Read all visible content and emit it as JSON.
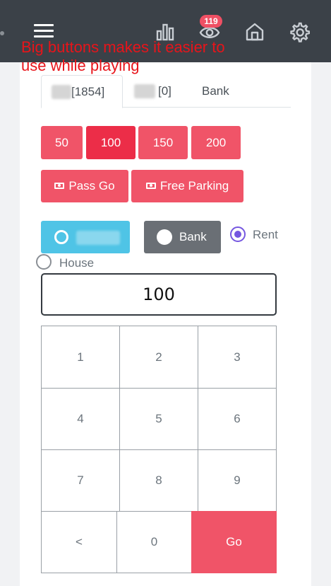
{
  "annotation": "Big buttons makes it easier to use while playing",
  "nav": {
    "menu_icon": "hamburger-menu-icon",
    "icons": [
      "bar-chart-icon",
      "eye-icon",
      "home-icon",
      "gear-icon"
    ],
    "eye_badge": "119"
  },
  "tabs": [
    {
      "label": "[1854]",
      "active": true
    },
    {
      "label": "[0]",
      "active": false
    },
    {
      "label": "Bank",
      "active": false
    }
  ],
  "amount_buttons": [
    "50",
    "100",
    "150",
    "200"
  ],
  "selected_amount": "100",
  "action_buttons": [
    {
      "label": "Pass Go",
      "icon": "money-icon"
    },
    {
      "label": "Free Parking",
      "icon": "money-icon"
    }
  ],
  "target_options": {
    "player_label": "",
    "bank_label": "Bank",
    "rent_label": "Rent",
    "house_label": "House",
    "rent_checked": true,
    "house_checked": false
  },
  "amount_input": {
    "value": "100"
  },
  "keypad": {
    "rows": [
      [
        "1",
        "2",
        "3"
      ],
      [
        "4",
        "5",
        "6"
      ],
      [
        "7",
        "8",
        "9"
      ]
    ],
    "back_label": "<",
    "zero_label": "0",
    "go_label": "Go"
  },
  "colors": {
    "topbar": "#3b4148",
    "accent_pink": "#f05468",
    "selected_red": "#ec2d48",
    "cyan": "#4fc4e6",
    "gray": "#6a6f75",
    "radio_purple": "#7557e0",
    "annotation_red": "#e8141a"
  }
}
